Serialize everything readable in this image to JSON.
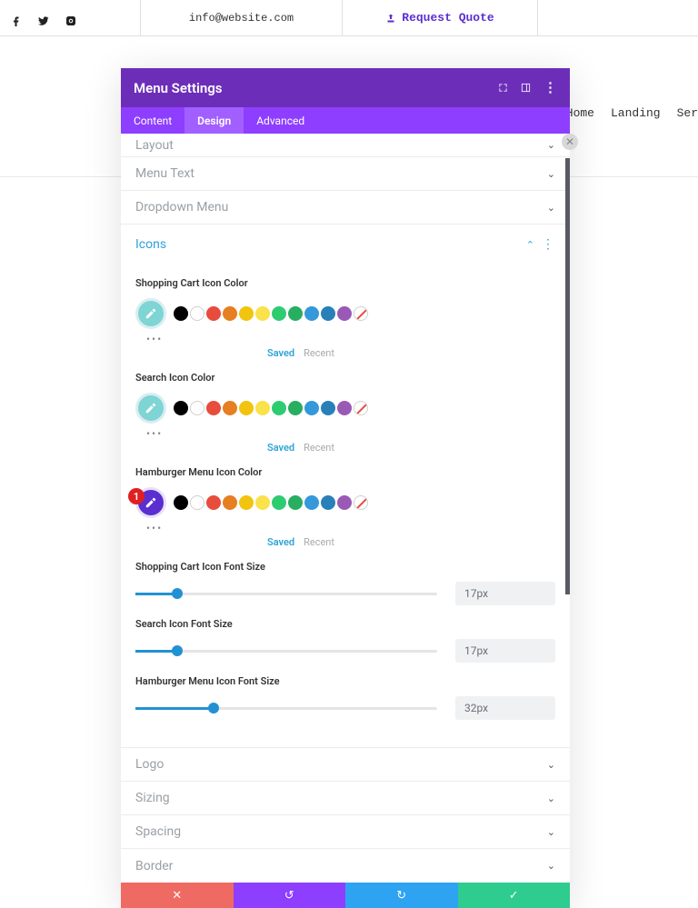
{
  "topbar": {
    "email": "info@website.com",
    "quote_label": "Request Quote"
  },
  "nav": {
    "items": [
      "Home",
      "Landing",
      "Ser"
    ]
  },
  "modal": {
    "title": "Menu Settings",
    "tabs": {
      "content": "Content",
      "design": "Design",
      "advanced": "Advanced"
    },
    "sections": {
      "layout": "Layout",
      "menu_text": "Menu Text",
      "dropdown": "Dropdown Menu",
      "icons": "Icons",
      "logo": "Logo",
      "sizing": "Sizing",
      "spacing": "Spacing",
      "border": "Border"
    },
    "icons_panel": {
      "color1_label": "Shopping Cart Icon Color",
      "color2_label": "Search Icon Color",
      "color3_label": "Hamburger Menu Icon Color",
      "saved": "Saved",
      "recent": "Recent",
      "badge": "1",
      "size1_label": "Shopping Cart Icon Font Size",
      "size1_value": "17px",
      "size1_pct": 14,
      "size2_label": "Search Icon Font Size",
      "size2_value": "17px",
      "size2_pct": 14,
      "size3_label": "Hamburger Menu Icon Font Size",
      "size3_value": "32px",
      "size3_pct": 26,
      "palette": [
        "#000000",
        "#ffffff",
        "#e74c3c",
        "#e67e22",
        "#f1c40f",
        "#f9e24a",
        "#2ecc71",
        "#27ae60",
        "#3498db",
        "#2980b9",
        "#9b59b6"
      ],
      "picker_default": "#7fd4d4",
      "picker_hamburger": "#5b2ed0"
    }
  }
}
